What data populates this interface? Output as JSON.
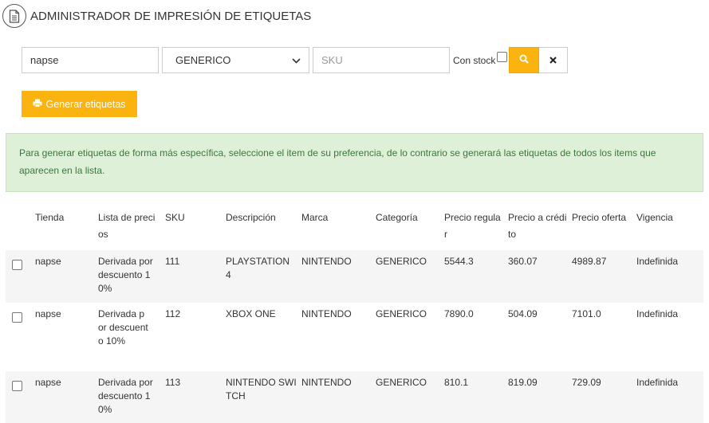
{
  "header": {
    "title": "ADMINISTRADOR DE IMPRESIÓN DE ETIQUETAS",
    "icon": "document-icon"
  },
  "filters": {
    "store_value": "napse",
    "category_selected": "GENERICO",
    "sku_placeholder": "SKU",
    "stock_label": "Con stock",
    "stock_checked": false,
    "search_icon": "search-icon",
    "clear_icon": "close-icon"
  },
  "actions": {
    "generate_label": "Generar etiquetas",
    "generate_icon": "print-icon"
  },
  "alert": {
    "text": "Para generar etiquetas de forma más específica, seleccione el item de su preferencia, de lo contrario se generará las etiquetas de todos los items que aparecen en la lista."
  },
  "colors": {
    "accent": "#fbb40f",
    "alert_bg": "#dff0d8",
    "alert_text": "#3c763d",
    "row_alt": "#f5f5f5"
  },
  "table": {
    "headers": [
      "Tienda",
      "Lista de precios",
      "SKU",
      "Descripción",
      "Marca",
      "Categoría",
      "Precio regular",
      "Precio a crédito",
      "Precio oferta",
      "Vigencia"
    ],
    "rows": [
      {
        "store": "napse",
        "price_list": "Derivada por descuento 10%",
        "sku": "111",
        "description": "PLAYSTATION 4",
        "brand": "NINTENDO",
        "category": "GENERICO",
        "regular": "5544.3",
        "credit": "360.07",
        "offer": "4989.87",
        "validity": "Indefinida"
      },
      {
        "store": "napse",
        "price_list": "Derivada por descuento 10%",
        "sku": "112",
        "description": "XBOX ONE",
        "brand": "NINTENDO",
        "category": "GENERICO",
        "regular": "7890.0",
        "credit": "504.09",
        "offer": "7101.0",
        "validity": "Indefinida"
      },
      {
        "store": "napse",
        "price_list": "Derivada por descuento 10%",
        "sku": "113",
        "description": "NINTENDO SWITCH",
        "brand": "NINTENDO",
        "category": "GENERICO",
        "regular": "810.1",
        "credit": "819.09",
        "offer": "729.09",
        "validity": "Indefinida"
      }
    ]
  }
}
